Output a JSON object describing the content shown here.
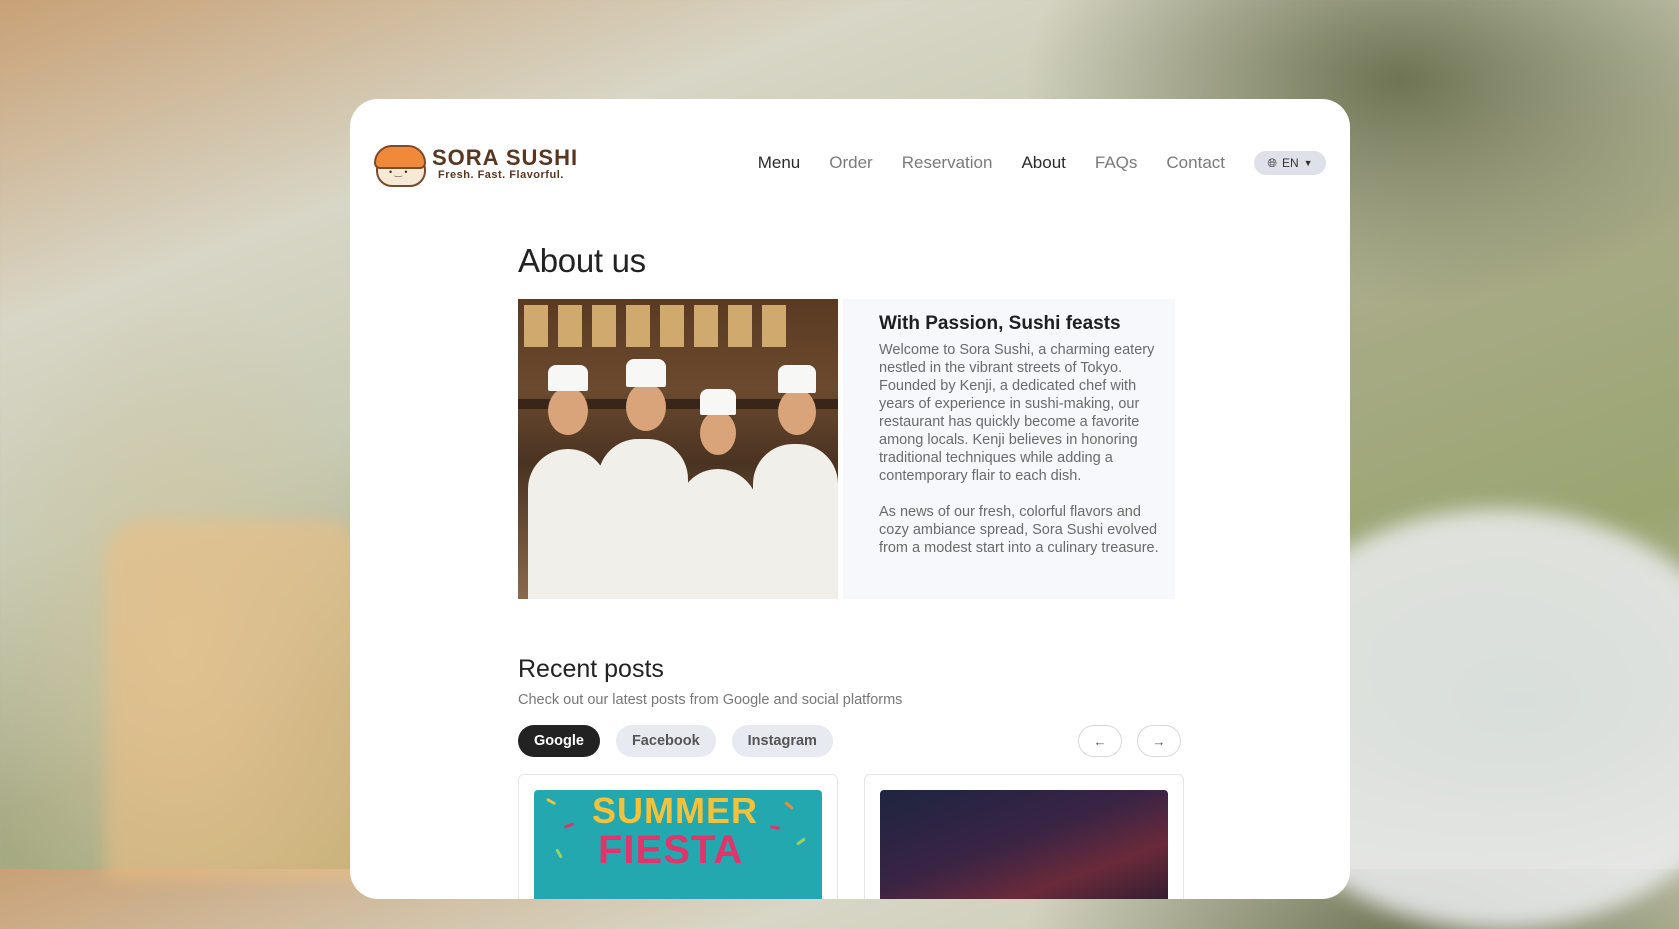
{
  "brand": {
    "name": "SORA SUSHI",
    "tagline": "Fresh. Fast. Flavorful.",
    "color": "#5a3520"
  },
  "nav": {
    "items": [
      {
        "label": "Menu",
        "active": true
      },
      {
        "label": "Order",
        "active": false
      },
      {
        "label": "Reservation",
        "active": false
      },
      {
        "label": "About",
        "active": true
      },
      {
        "label": "FAQs",
        "active": false
      },
      {
        "label": "Contact",
        "active": false
      }
    ],
    "language": "EN"
  },
  "about": {
    "title": "About us",
    "heading": "With Passion, Sushi feasts",
    "paragraph1": "Welcome to Sora Sushi, a charming eatery nestled in the vibrant streets of Tokyo. Founded by Kenji, a dedicated chef with years of experience in sushi-making, our restaurant has quickly become a favorite among locals. Kenji believes in honoring traditional techniques while adding a contemporary flair to each dish.",
    "paragraph2": "As news of our fresh, colorful flavors and cozy ambiance spread, Sora Sushi evolved from a modest start into a culinary treasure."
  },
  "recent_posts": {
    "title": "Recent posts",
    "subtitle": "Check out our latest posts from Google and social platforms",
    "filters": [
      {
        "label": "Google",
        "active": true
      },
      {
        "label": "Facebook",
        "active": false
      },
      {
        "label": "Instagram",
        "active": false
      }
    ],
    "prev_label": "←",
    "next_label": "→",
    "posts": [
      {
        "image_text_1": "SUMMER",
        "image_text_2": "FIESTA"
      },
      {
        "image": "night-scene"
      }
    ]
  },
  "colors": {
    "accent_dark": "#222222",
    "chip_bg": "#e8eaf2",
    "about_panel_bg": "#f7f8fb"
  }
}
